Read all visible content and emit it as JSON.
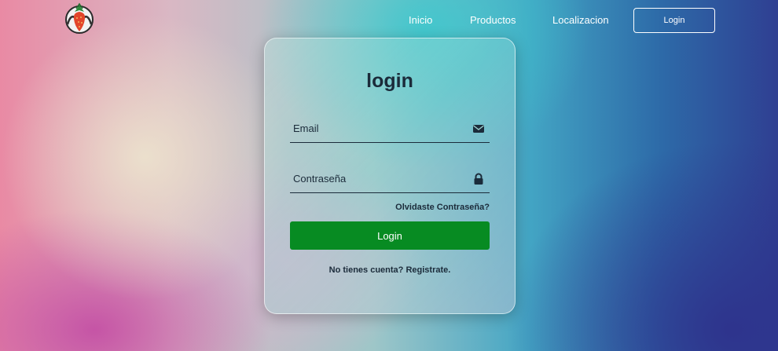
{
  "nav": {
    "logo_icon": "strawberry-logo-icon",
    "links": [
      {
        "label": "Inicio"
      },
      {
        "label": "Productos"
      },
      {
        "label": "Localizacion"
      }
    ],
    "login_label": "Login"
  },
  "login_form": {
    "title": "login",
    "email_placeholder": "Email",
    "email_icon": "envelope-icon",
    "password_placeholder": "Contraseña",
    "password_icon": "lock-icon",
    "forgot_label": "Olvidaste Contraseña?",
    "submit_label": "Login",
    "register_text": "No tienes cuenta?",
    "register_link": "Registrate."
  },
  "colors": {
    "primary_button": "#078b22",
    "text_dark": "#1b2b3a"
  }
}
